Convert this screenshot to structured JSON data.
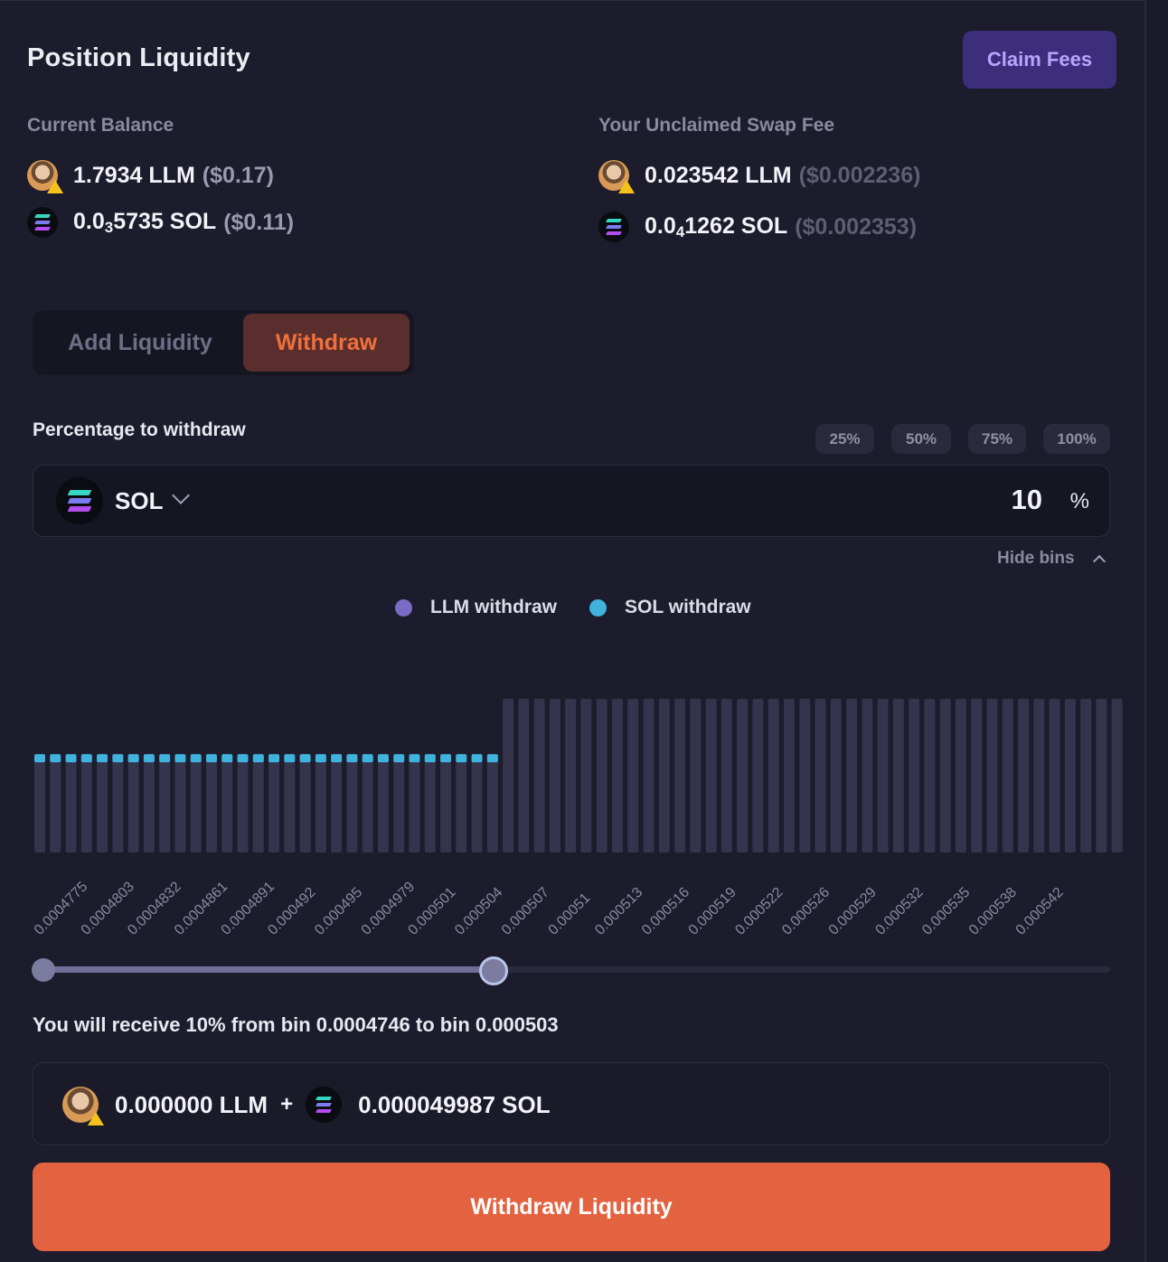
{
  "header": {
    "title": "Position Liquidity",
    "claim_label": "Claim Fees"
  },
  "balance": {
    "label": "Current Balance",
    "llm_amount": "1.7934 LLM",
    "llm_usd": "($0.17)",
    "sol_prefix": "0.0",
    "sol_sub": "3",
    "sol_rest": "5735 SOL",
    "sol_usd": "($0.11)"
  },
  "unclaimed": {
    "label": "Your Unclaimed Swap Fee",
    "llm_amount": "0.023542 LLM",
    "llm_usd": "($0.002236)",
    "sol_prefix": "0.0",
    "sol_sub": "4",
    "sol_rest": "1262 SOL",
    "sol_usd": "($0.002353)"
  },
  "tabs": {
    "add": "Add Liquidity",
    "withdraw": "Withdraw"
  },
  "withdraw": {
    "label": "Percentage to withdraw",
    "presets": [
      "25%",
      "50%",
      "75%",
      "100%"
    ],
    "token": "SOL",
    "percent_value": "10",
    "percent_sign": "%",
    "hide_bins": "Hide bins"
  },
  "legend": {
    "llm": "LLM withdraw",
    "sol": "SOL withdraw"
  },
  "colors": {
    "llm": "#7a6cc6",
    "sol": "#3fb2dd",
    "bar": "#34344c",
    "accent": "#e36340"
  },
  "chart_data": {
    "type": "bar",
    "total_bins": 70,
    "sol_bins": 30,
    "llm_bins": 40,
    "sol_bin_level": 0.64,
    "llm_bin_level": 1.0,
    "tick_labels": [
      "0.0004775",
      "0.0004803",
      "0.0004832",
      "0.0004861",
      "0.0004891",
      "0.000492",
      "0.000495",
      "0.0004979",
      "0.000501",
      "0.000504",
      "0.000507",
      "0.00051",
      "0.000513",
      "0.000516",
      "0.000519",
      "0.000522",
      "0.000526",
      "0.000529",
      "0.000532",
      "0.000535",
      "0.000538",
      "0.000542"
    ]
  },
  "range_slider": {
    "selected_fraction_start": 0.0,
    "selected_fraction_end": 0.42
  },
  "receive": {
    "text": "You will receive 10% from bin 0.0004746 to bin 0.000503",
    "llm_amount": "0.000000 LLM",
    "plus": "+",
    "sol_amount": "0.000049987 SOL"
  },
  "action": {
    "label": "Withdraw Liquidity"
  }
}
